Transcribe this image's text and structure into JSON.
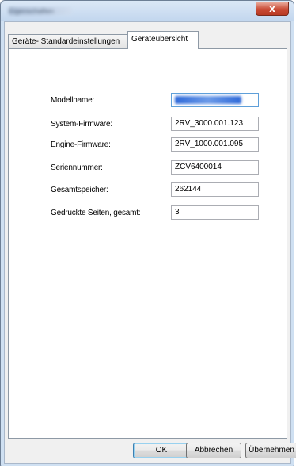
{
  "window": {
    "title": "Eigenschaften",
    "close_glyph": "x"
  },
  "tabs": [
    {
      "label": "Geräte- Standardeinstellungen",
      "active": false
    },
    {
      "label": "Geräteübersicht",
      "active": true
    }
  ],
  "fields": [
    {
      "label": "Modellname:",
      "value": "",
      "redacted": true
    },
    {
      "label": "System-Firmware:",
      "value": "2RV_3000.001.123"
    },
    {
      "label": "Engine-Firmware:",
      "value": "2RV_1000.001.095"
    },
    {
      "label": "Seriennummer:",
      "value": "ZCV6400014"
    },
    {
      "label": "Gesamtspeicher:",
      "value": "262144"
    },
    {
      "label": "Gedruckte Seiten, gesamt:",
      "value": "3"
    }
  ],
  "buttons": {
    "ok": "OK",
    "cancel": "Abbrechen",
    "apply": "Übernehmen"
  },
  "colors": {
    "accent": "#3c7fb1",
    "close": "#c94a34",
    "frame": "#cfe0f2"
  }
}
